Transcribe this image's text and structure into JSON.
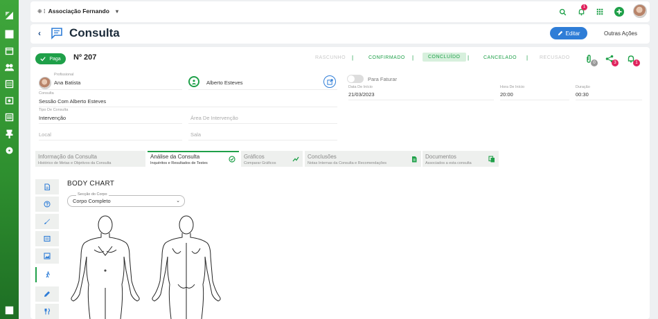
{
  "topbar": {
    "org_name": "Associação Fernando",
    "notifications_count": "1"
  },
  "header": {
    "title": "Consulta",
    "edit_label": "Editar",
    "other_actions_label": "Outras Ações"
  },
  "consult": {
    "paid_label": "Paga",
    "number": "Nº 207",
    "statuses": [
      "RASCUNHO",
      "CONFIRMADO",
      "CONCLUÍDO",
      "CANCELADO",
      "RECUSADO"
    ],
    "attachments_count": "0",
    "shares_count": "3",
    "alerts_count": "1"
  },
  "fields": {
    "profissional_label": "Profissional",
    "profissional_value": "Ana Batista",
    "client_value": "Alberto Esteves",
    "para_faturar_label": "Para Faturar",
    "consulta_label": "Consulta",
    "consulta_value": "Sessão Com Alberto Esteves",
    "data_inicio_label": "Data De Início",
    "data_inicio_value": "21/03/2023",
    "hora_inicio_label": "Hora De Início",
    "hora_inicio_value": "20:00",
    "duracao_label": "Duração",
    "duracao_value": "00:30",
    "tipo_label": "Tipo De Consulta",
    "tipo_value": "Intervenção",
    "area_placeholder": "Área De Intervenção",
    "local_placeholder": "Local",
    "sala_placeholder": "Sala"
  },
  "tabs": [
    {
      "title": "Informação da Consulta",
      "subtitle": "Histórico de Metas e Objetivos da Consulta"
    },
    {
      "title": "Análise da Consulta",
      "subtitle": "Inquéritos e Resultados de Testes"
    },
    {
      "title": "Gráficos",
      "subtitle": "Comparar Gráficos"
    },
    {
      "title": "Conclusões",
      "subtitle": "Notas Internas da Consulta e Recomendações"
    },
    {
      "title": "Documentos",
      "subtitle": "Associados a esta consulta"
    }
  ],
  "body_chart": {
    "title": "BODY CHART",
    "select_label": "Secção do Corpo",
    "select_value": "Corpo Completo"
  },
  "colors": {
    "green": "#1fa049",
    "blue": "#2e7dd7",
    "badge": "#e0245e"
  }
}
